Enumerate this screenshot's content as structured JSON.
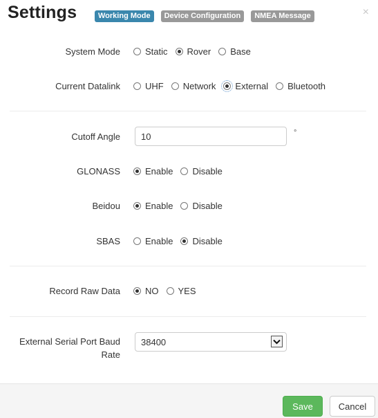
{
  "header": {
    "title": "Settings",
    "tabs": [
      {
        "label": "Working Mode",
        "active": true
      },
      {
        "label": "Device Configuration",
        "active": false
      },
      {
        "label": "NMEA Message",
        "active": false
      }
    ],
    "close_icon": "×"
  },
  "system_mode": {
    "label": "System Mode",
    "options": [
      "Static",
      "Rover",
      "Base"
    ],
    "selected": "Rover"
  },
  "datalink": {
    "label": "Current Datalink",
    "options": [
      "UHF",
      "Network",
      "External",
      "Bluetooth"
    ],
    "selected": "External"
  },
  "cutoff": {
    "label": "Cutoff Angle",
    "value": "10",
    "unit": "°"
  },
  "glonass": {
    "label": "GLONASS",
    "options": [
      "Enable",
      "Disable"
    ],
    "selected": "Enable"
  },
  "beidou": {
    "label": "Beidou",
    "options": [
      "Enable",
      "Disable"
    ],
    "selected": "Enable"
  },
  "sbas": {
    "label": "SBAS",
    "options": [
      "Enable",
      "Disable"
    ],
    "selected": "Disable"
  },
  "raw_data": {
    "label": "Record Raw Data",
    "options": [
      "NO",
      "YES"
    ],
    "selected": "NO"
  },
  "baud": {
    "label": "External Serial Port Baud Rate",
    "value": "38400"
  },
  "footer": {
    "save_label": "Save",
    "cancel_label": "Cancel"
  },
  "colors": {
    "tab_active": "#3a87ad",
    "tab_inactive": "#999999",
    "save_button": "#5cb85c"
  }
}
